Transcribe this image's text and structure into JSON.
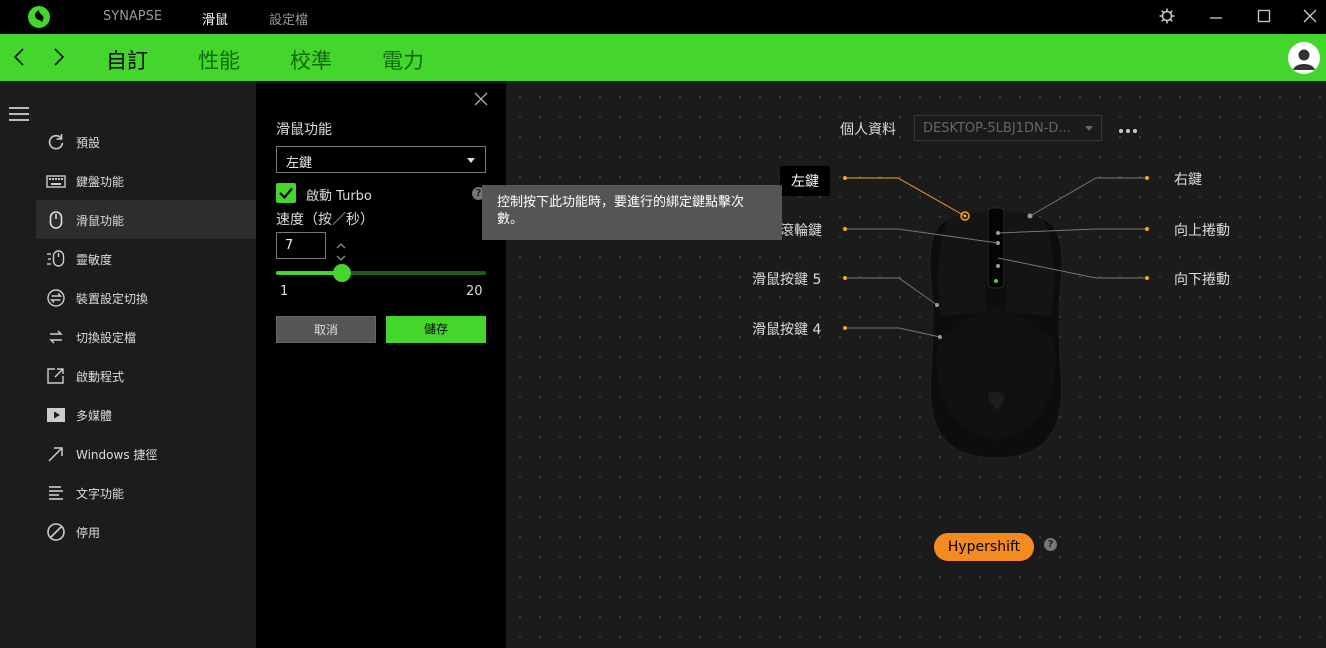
{
  "titlebar": {
    "tabs": [
      {
        "label": "SYNAPSE",
        "active": false
      },
      {
        "label": "滑鼠",
        "active": true
      },
      {
        "label": "設定檔",
        "active": false
      }
    ]
  },
  "subnav": {
    "tabs": [
      {
        "label": "自訂",
        "active": true
      },
      {
        "label": "性能",
        "active": false
      },
      {
        "label": "校準",
        "active": false
      },
      {
        "label": "電力",
        "active": false
      }
    ]
  },
  "sidebar": {
    "items": [
      {
        "label": "預設",
        "icon": "reset-icon",
        "active": false
      },
      {
        "label": "鍵盤功能",
        "icon": "keyboard-icon",
        "active": false
      },
      {
        "label": "滑鼠功能",
        "icon": "mouse-icon",
        "active": true
      },
      {
        "label": "靈敏度",
        "icon": "sensitivity-icon",
        "active": false
      },
      {
        "label": "裝置設定切換",
        "icon": "device-switch-icon",
        "active": false
      },
      {
        "label": "切換設定檔",
        "icon": "swap-profile-icon",
        "active": false
      },
      {
        "label": "啟動程式",
        "icon": "launch-program-icon",
        "active": false
      },
      {
        "label": "多媒體",
        "icon": "play-icon",
        "active": false
      },
      {
        "label": "Windows 捷徑",
        "icon": "arrow-shortcut-icon",
        "active": false
      },
      {
        "label": "文字功能",
        "icon": "text-icon",
        "active": false
      },
      {
        "label": "停用",
        "icon": "disable-icon",
        "active": false
      }
    ]
  },
  "panel": {
    "title": "滑鼠功能",
    "function_select": "左鍵",
    "turbo_label": "啟動 Turbo",
    "turbo_checked": true,
    "speed_label": "速度（按／秒）",
    "speed_value": "7",
    "slider": {
      "min": "1",
      "max": "20",
      "value": 7
    },
    "cancel_label": "取消",
    "save_label": "儲存"
  },
  "tooltip": {
    "text": "控制按下此功能時，要進行的綁定鍵點擊次數。"
  },
  "canvas": {
    "profile_label": "個人資料",
    "profile_value": "DESKTOP-5LBJ1DN-D...",
    "left_buttons": [
      "左鍵",
      "滾輪鍵",
      "滑鼠按鍵 5",
      "滑鼠按鍵 4"
    ],
    "right_buttons": [
      "右鍵",
      "向上捲動",
      "向下捲動"
    ],
    "selected_button": "左鍵",
    "hypershift_label": "Hypershift"
  },
  "colors": {
    "accent": "#44d62c",
    "hypershift": "#f58a1f",
    "connector": "#f5a623"
  }
}
